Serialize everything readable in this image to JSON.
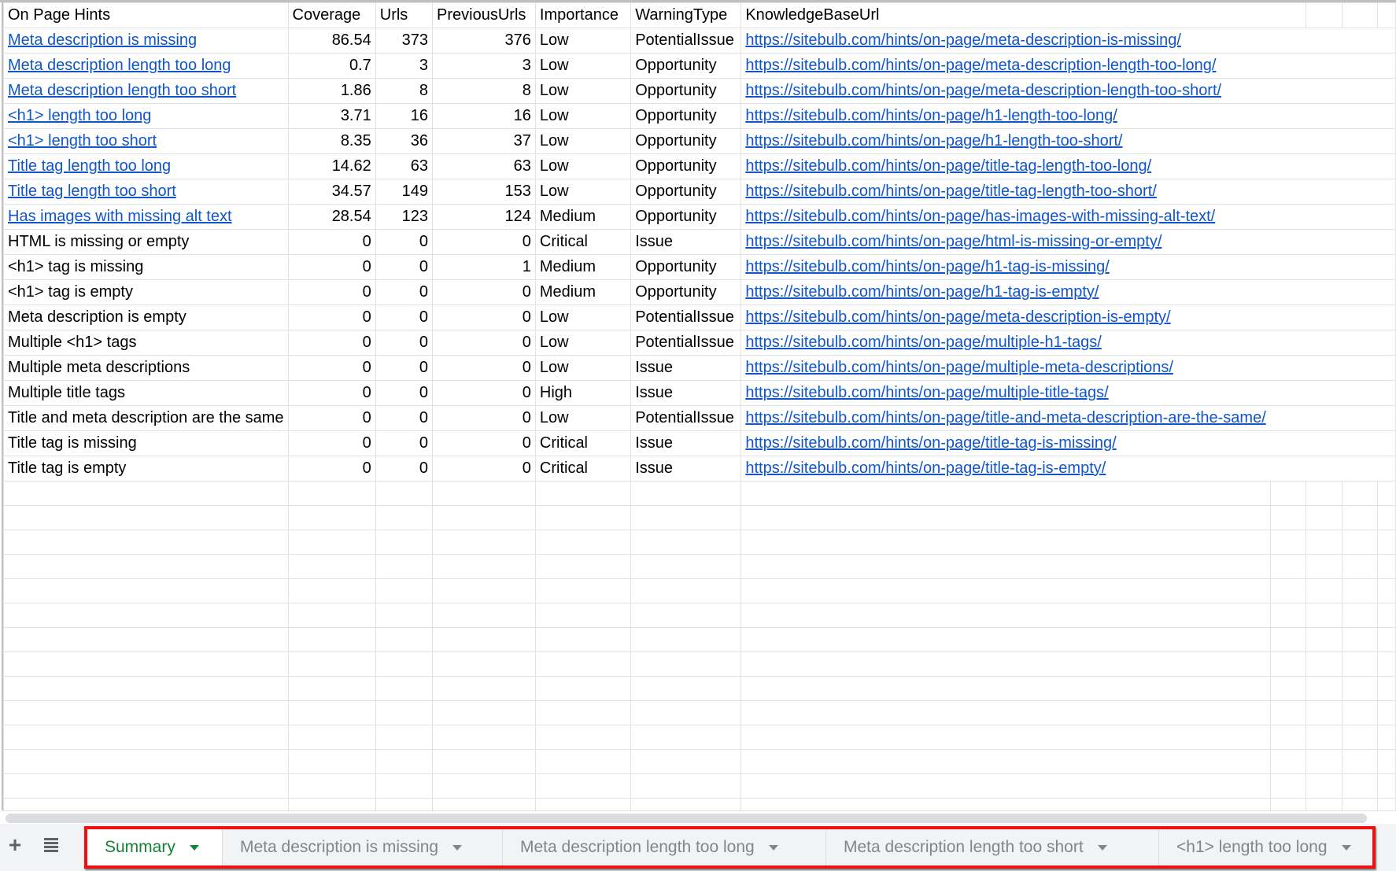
{
  "sheet": {
    "headers": [
      "On Page Hints",
      "Coverage",
      "Urls",
      "PreviousUrls",
      "Importance",
      "WarningType",
      "KnowledgeBaseUrl"
    ],
    "rows": [
      {
        "hint": "Meta description is missing",
        "hint_is_link": true,
        "coverage": "86.54",
        "urls": "373",
        "previous_urls": "376",
        "importance": "Low",
        "warning_type": "PotentialIssue",
        "kb_url": "https://sitebulb.com/hints/on-page/meta-description-is-missing/"
      },
      {
        "hint": "Meta description length too long",
        "hint_is_link": true,
        "coverage": "0.7",
        "urls": "3",
        "previous_urls": "3",
        "importance": "Low",
        "warning_type": "Opportunity",
        "kb_url": "https://sitebulb.com/hints/on-page/meta-description-length-too-long/"
      },
      {
        "hint": "Meta description length too short",
        "hint_is_link": true,
        "coverage": "1.86",
        "urls": "8",
        "previous_urls": "8",
        "importance": "Low",
        "warning_type": "Opportunity",
        "kb_url": "https://sitebulb.com/hints/on-page/meta-description-length-too-short/"
      },
      {
        "hint": "<h1> length too long",
        "hint_is_link": true,
        "coverage": "3.71",
        "urls": "16",
        "previous_urls": "16",
        "importance": "Low",
        "warning_type": "Opportunity",
        "kb_url": "https://sitebulb.com/hints/on-page/h1-length-too-long/"
      },
      {
        "hint": "<h1> length too short",
        "hint_is_link": true,
        "coverage": "8.35",
        "urls": "36",
        "previous_urls": "37",
        "importance": "Low",
        "warning_type": "Opportunity",
        "kb_url": "https://sitebulb.com/hints/on-page/h1-length-too-short/"
      },
      {
        "hint": "Title tag length too long",
        "hint_is_link": true,
        "coverage": "14.62",
        "urls": "63",
        "previous_urls": "63",
        "importance": "Low",
        "warning_type": "Opportunity",
        "kb_url": "https://sitebulb.com/hints/on-page/title-tag-length-too-long/"
      },
      {
        "hint": "Title tag length too short",
        "hint_is_link": true,
        "coverage": "34.57",
        "urls": "149",
        "previous_urls": "153",
        "importance": "Low",
        "warning_type": "Opportunity",
        "kb_url": "https://sitebulb.com/hints/on-page/title-tag-length-too-short/"
      },
      {
        "hint": "Has images with missing alt text",
        "hint_is_link": true,
        "coverage": "28.54",
        "urls": "123",
        "previous_urls": "124",
        "importance": "Medium",
        "warning_type": "Opportunity",
        "kb_url": "https://sitebulb.com/hints/on-page/has-images-with-missing-alt-text/"
      },
      {
        "hint": "HTML is missing or empty",
        "hint_is_link": false,
        "coverage": "0",
        "urls": "0",
        "previous_urls": "0",
        "importance": "Critical",
        "warning_type": "Issue",
        "kb_url": "https://sitebulb.com/hints/on-page/html-is-missing-or-empty/"
      },
      {
        "hint": "<h1> tag is missing",
        "hint_is_link": false,
        "coverage": "0",
        "urls": "0",
        "previous_urls": "1",
        "importance": "Medium",
        "warning_type": "Opportunity",
        "kb_url": "https://sitebulb.com/hints/on-page/h1-tag-is-missing/"
      },
      {
        "hint": "<h1> tag is empty",
        "hint_is_link": false,
        "coverage": "0",
        "urls": "0",
        "previous_urls": "0",
        "importance": "Medium",
        "warning_type": "Opportunity",
        "kb_url": "https://sitebulb.com/hints/on-page/h1-tag-is-empty/"
      },
      {
        "hint": "Meta description is empty",
        "hint_is_link": false,
        "coverage": "0",
        "urls": "0",
        "previous_urls": "0",
        "importance": "Low",
        "warning_type": "PotentialIssue",
        "kb_url": "https://sitebulb.com/hints/on-page/meta-description-is-empty/"
      },
      {
        "hint": "Multiple <h1> tags",
        "hint_is_link": false,
        "coverage": "0",
        "urls": "0",
        "previous_urls": "0",
        "importance": "Low",
        "warning_type": "PotentialIssue",
        "kb_url": "https://sitebulb.com/hints/on-page/multiple-h1-tags/"
      },
      {
        "hint": "Multiple meta descriptions",
        "hint_is_link": false,
        "coverage": "0",
        "urls": "0",
        "previous_urls": "0",
        "importance": "Low",
        "warning_type": "Issue",
        "kb_url": "https://sitebulb.com/hints/on-page/multiple-meta-descriptions/"
      },
      {
        "hint": "Multiple title tags",
        "hint_is_link": false,
        "coverage": "0",
        "urls": "0",
        "previous_urls": "0",
        "importance": "High",
        "warning_type": "Issue",
        "kb_url": "https://sitebulb.com/hints/on-page/multiple-title-tags/"
      },
      {
        "hint": "Title and meta description are the same",
        "hint_is_link": false,
        "coverage": "0",
        "urls": "0",
        "previous_urls": "0",
        "importance": "Low",
        "warning_type": "PotentialIssue",
        "kb_url": "https://sitebulb.com/hints/on-page/title-and-meta-description-are-the-same/"
      },
      {
        "hint": "Title tag is missing",
        "hint_is_link": false,
        "coverage": "0",
        "urls": "0",
        "previous_urls": "0",
        "importance": "Critical",
        "warning_type": "Issue",
        "kb_url": "https://sitebulb.com/hints/on-page/title-tag-is-missing/"
      },
      {
        "hint": "Title tag is empty",
        "hint_is_link": false,
        "coverage": "0",
        "urls": "0",
        "previous_urls": "0",
        "importance": "Critical",
        "warning_type": "Issue",
        "kb_url": "https://sitebulb.com/hints/on-page/title-tag-is-empty/"
      }
    ]
  },
  "tabbar": {
    "add_sheet_icon": "plus-icon",
    "all_sheets_icon": "list-icon",
    "add_sheet_glyph": "+",
    "tabs": [
      {
        "label": "Summary",
        "active": true
      },
      {
        "label": "Meta description is missing",
        "active": false
      },
      {
        "label": "Meta description length too long",
        "active": false
      },
      {
        "label": "Meta description length too short",
        "active": false
      },
      {
        "label": "<h1> length too long",
        "active": false
      }
    ]
  },
  "colors": {
    "link": "#1155cc",
    "active_tab_text": "#188038",
    "inactive_tab_text": "#80868b",
    "highlight_box": "#ee1111",
    "tabbar_bg": "#f1f3f4",
    "gridline": "#e2e2e2"
  }
}
